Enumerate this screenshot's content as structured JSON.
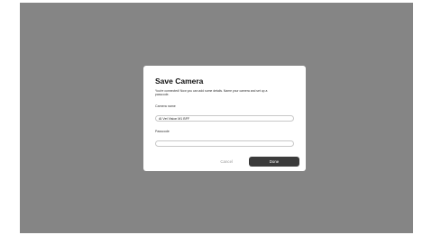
{
  "dialog": {
    "title": "Save Camera",
    "description": "You're connected! Now you can add some details.  Name your camera and set up a passcode.",
    "camera_name": {
      "label": "Camera name",
      "value": "AI Vet Vision M1 BFF"
    },
    "passcode": {
      "label": "Passcode",
      "value": ""
    },
    "cancel_label": "Cancel",
    "done_label": "Done"
  },
  "colors": {
    "backdrop": "#858585",
    "dialog_bg": "#ffffff",
    "primary_button": "#3b3b3b",
    "cancel_text": "#9a9a9a"
  }
}
